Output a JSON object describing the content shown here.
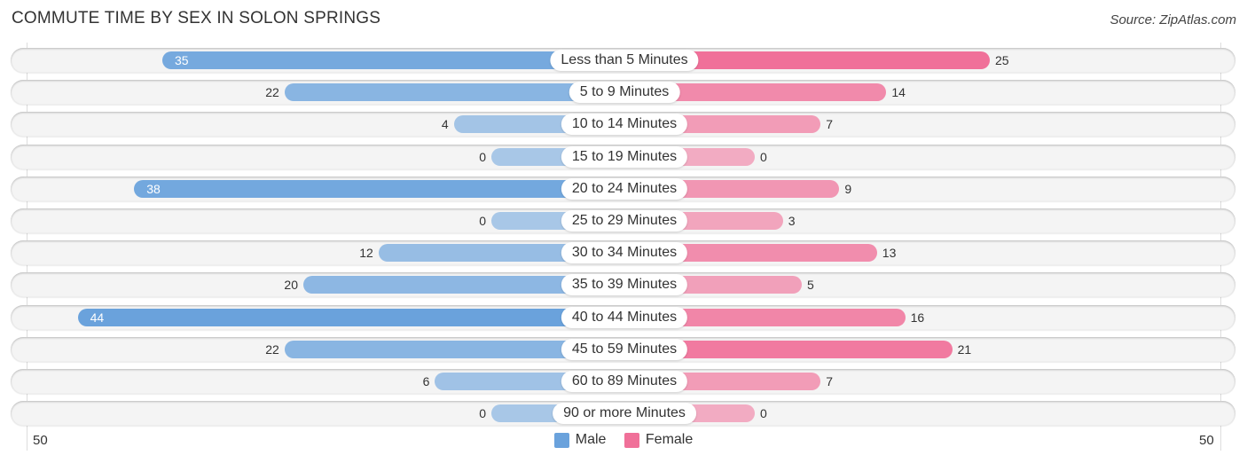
{
  "header": {
    "title": "COMMUTE TIME BY SEX IN SOLON SPRINGS",
    "source": "Source: ZipAtlas.com"
  },
  "colors": {
    "male": "#6aa2dc",
    "female": "#f07099"
  },
  "chart_data": {
    "type": "bar",
    "orientation": "horizontal-diverging",
    "title": "COMMUTE TIME BY SEX IN SOLON SPRINGS",
    "categories": [
      "Less than 5 Minutes",
      "5 to 9 Minutes",
      "10 to 14 Minutes",
      "15 to 19 Minutes",
      "20 to 24 Minutes",
      "25 to 29 Minutes",
      "30 to 34 Minutes",
      "35 to 39 Minutes",
      "40 to 44 Minutes",
      "45 to 59 Minutes",
      "60 to 89 Minutes",
      "90 or more Minutes"
    ],
    "series": [
      {
        "name": "Male",
        "values": [
          35,
          22,
          4,
          0,
          38,
          0,
          12,
          20,
          44,
          22,
          6,
          0
        ]
      },
      {
        "name": "Female",
        "values": [
          25,
          14,
          7,
          0,
          9,
          3,
          13,
          5,
          16,
          21,
          7,
          0
        ]
      }
    ],
    "axis": {
      "left_tick": "50",
      "right_tick": "50",
      "max": 50
    },
    "legend": [
      "Male",
      "Female"
    ],
    "legend_position": "bottom-center"
  }
}
